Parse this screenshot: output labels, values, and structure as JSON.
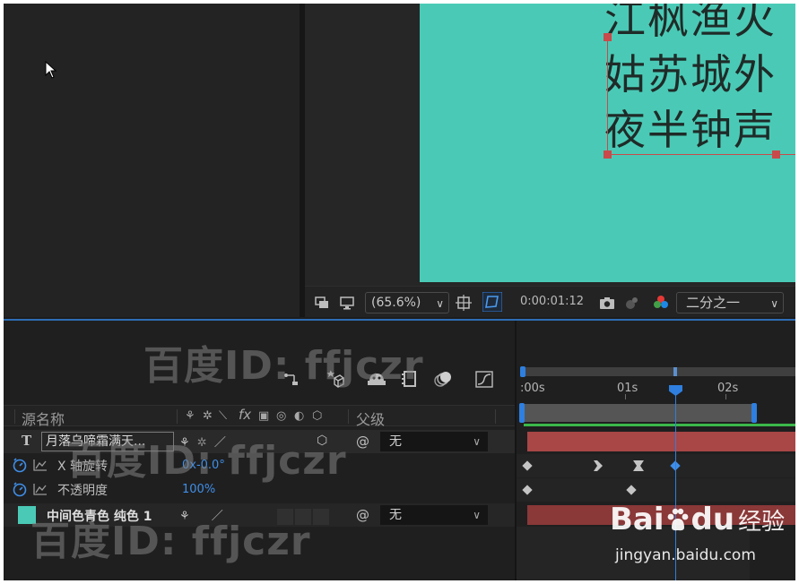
{
  "poem": {
    "lines": [
      "江枫渔火",
      "姑苏城外",
      "夜半钟声"
    ]
  },
  "viewer_toolbar": {
    "zoom": "(65.6%)",
    "timecode": "0:00:01:12",
    "resolution": "二分之一"
  },
  "timeline": {
    "columns": {
      "source_name": "源名称",
      "parent": "父级"
    },
    "layers": [
      {
        "type_icon": "T",
        "name": "月落乌啼霜满天...",
        "parent": "无"
      },
      {
        "name": "中间色青色 纯色 1",
        "parent": "无",
        "swatch_color": "#4acab6"
      }
    ],
    "properties": [
      {
        "name": "X 轴旋转",
        "value": "0x-0.0°"
      },
      {
        "name": "不透明度",
        "value": "100%"
      }
    ],
    "ruler": {
      "labels": [
        ":00s",
        "01s",
        "02s"
      ]
    }
  },
  "watermarks": {
    "baidu_id": "百度ID: ffjczr",
    "baidu_word": "Bai",
    "baidu_suffix": "du",
    "baidu_cn": "经验",
    "baidu_url": "jingyan.baidu.com"
  },
  "colors": {
    "canvas": "#4acab6",
    "accent": "#2e7fe0",
    "layer_bar": "#a94646"
  }
}
